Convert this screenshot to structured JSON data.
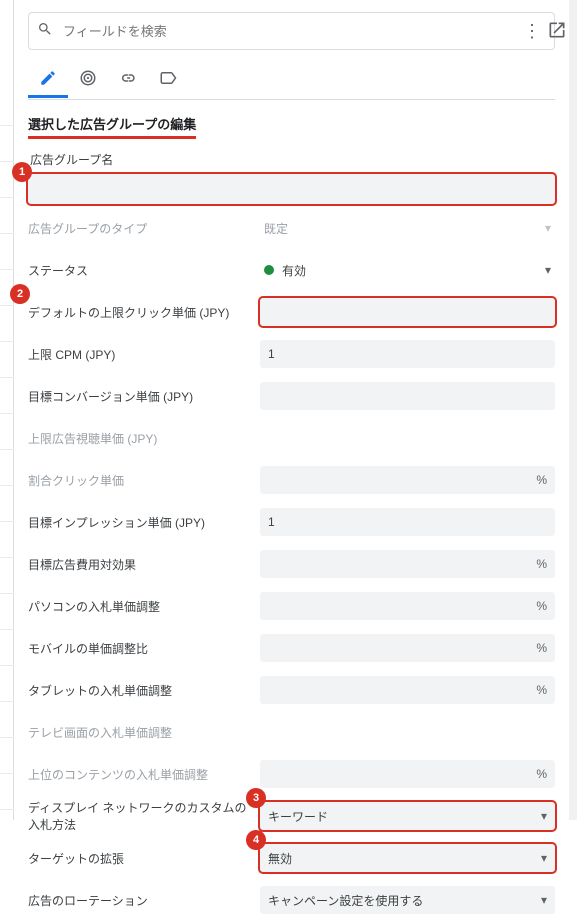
{
  "search": {
    "placeholder": "フィールドを検索"
  },
  "section_title": "選択した広告グループの編集",
  "badges": {
    "b1": "1",
    "b2": "2",
    "b3": "3",
    "b4": "4"
  },
  "labels": {
    "ad_group_name": "広告グループ名",
    "ad_group_type": "広告グループのタイプ",
    "status": "ステータス",
    "default_max_cpc": "デフォルトの上限クリック単価 (JPY)",
    "max_cpm": "上限 CPM (JPY)",
    "target_cpa": "目標コンバージョン単価 (JPY)",
    "max_cpv": "上限広告視聴単価 (JPY)",
    "percent_cpc": "割合クリック単価",
    "target_cpm": "目標インプレッション単価 (JPY)",
    "target_roas": "目標広告費用対効果",
    "desktop_bid_adj": "パソコンの入札単価調整",
    "mobile_bid_adj": "モバイルの単価調整比",
    "tablet_bid_adj": "タブレットの入札単価調整",
    "tv_bid_adj": "テレビ画面の入札単価調整",
    "top_content_bid_adj": "上位のコンテンツの入札単価調整",
    "display_custom_bid": "ディスプレイ ネットワークのカスタムの入札方法",
    "targeting_expansion": "ターゲットの拡張",
    "ad_rotation": "広告のローテーション"
  },
  "values": {
    "ad_group_name": "",
    "ad_group_type": "既定",
    "status": "有効",
    "default_max_cpc": "",
    "max_cpm": "1",
    "target_cpa": "",
    "max_cpv": "",
    "percent_cpc": "",
    "target_cpm": "1",
    "target_roas": "",
    "desktop_bid_adj": "",
    "mobile_bid_adj": "",
    "tablet_bid_adj": "",
    "tv_bid_adj": "",
    "top_content_bid_adj": "",
    "display_custom_bid": "キーワード",
    "targeting_expansion": "無効",
    "ad_rotation": "キャンペーン設定を使用する"
  },
  "unit_percent": "%"
}
